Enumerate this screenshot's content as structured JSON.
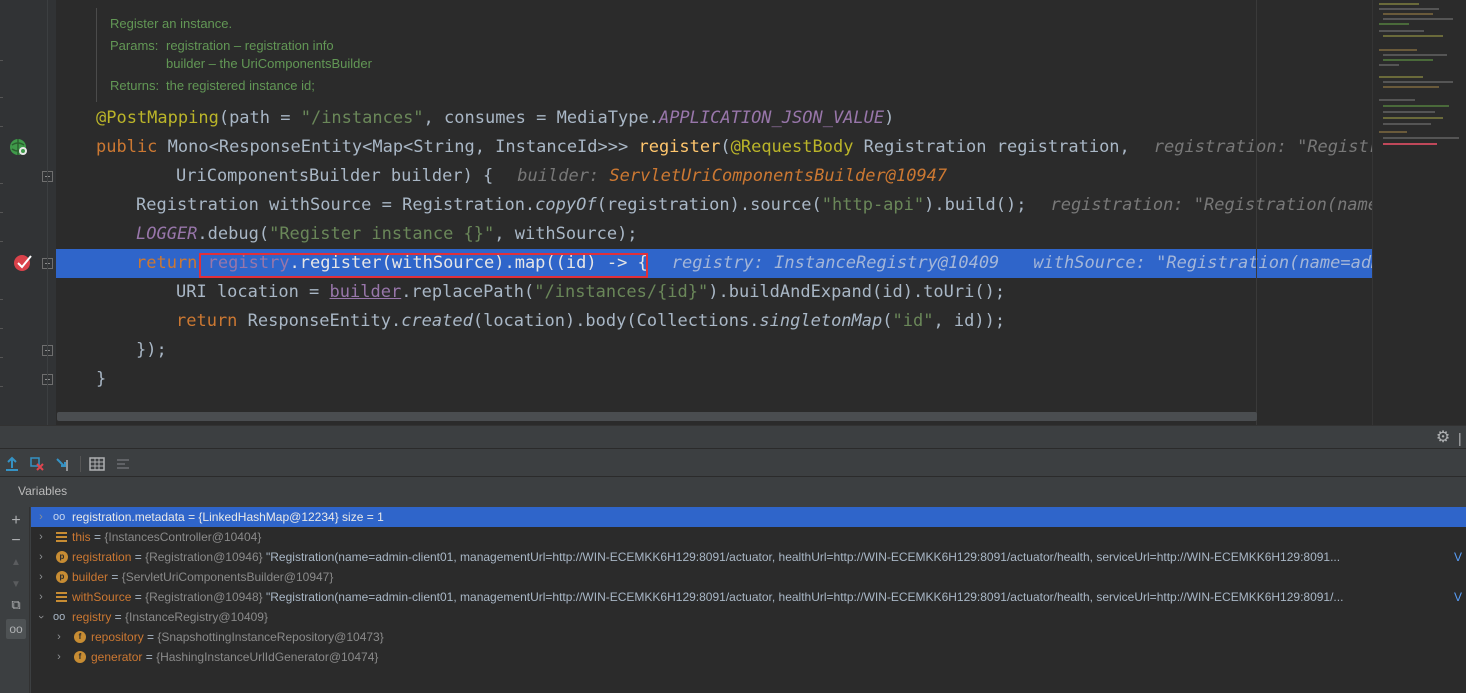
{
  "doc": {
    "summary": "Register an instance.",
    "params_label": "Params:",
    "param1": "registration – registration info",
    "param2": "builder – the UriComponentsBuilder",
    "returns_label": "Returns:",
    "returns": "the registered instance id;"
  },
  "code": {
    "l1_ann": "@PostMapping",
    "l1_a": "(path = ",
    "l1_str": "\"/instances\"",
    "l1_b": ", consumes = MediaType.",
    "l1_const": "APPLICATION_JSON_VALUE",
    "l1_c": ")",
    "l2_kw": "public ",
    "l2_a": "Mono<ResponseEntity<Map<String, InstanceId>>> ",
    "l2_fn": "register",
    "l2_b": "(",
    "l2_ann": "@RequestBody",
    "l2_c": " Registration registration,",
    "l2_hint_name": "registration: ",
    "l2_hint_val": "\"Registrat",
    "l3_a": "UriComponentsBuilder builder) {",
    "l3_hint_name": "builder: ",
    "l3_hint_val": "ServletUriComponentsBuilder@10947",
    "l4_a": "Registration withSource = Registration.",
    "l4_it": "copyOf",
    "l4_b": "(registration).source(",
    "l4_str": "\"http-api\"",
    "l4_c": ").build();",
    "l4_hint_name": "registration: ",
    "l4_hint_val": "\"Registration(name=ad",
    "l5_const": "LOGGER",
    "l5_a": ".debug(",
    "l5_str": "\"Register instance {}\"",
    "l5_b": ", withSource);",
    "l6_kw": "return ",
    "l6_fld": "registry",
    "l6_a": ".register(withSource).map((id) -> {",
    "l6_hint1": "registry: InstanceRegistry@10409",
    "l6_hint2": "withSource: \"Registration(name=admin",
    "l7_a": "URI location = ",
    "l7_u": "builder",
    "l7_b": ".replacePath(",
    "l7_str": "\"/instances/{id}\"",
    "l7_c": ").buildAndExpand(id).toUri();",
    "l8_kw": "return ",
    "l8_a": "ResponseEntity.",
    "l8_it": "created",
    "l8_b": "(location).body(Collections.",
    "l8_it2": "singletonMap",
    "l8_c": "(",
    "l8_str": "\"id\"",
    "l8_d": ", id));",
    "l9_a": "});",
    "l10_a": "}"
  },
  "debug": {
    "panel_title": "Variables",
    "settings_icon": "gear-icon",
    "vars": [
      {
        "name": "registration.metadata",
        "eq": " = ",
        "type": "{LinkedHashMap@12234}",
        "value": "  size = 1",
        "extra": ""
      },
      {
        "name": "this",
        "eq": " = ",
        "type": "{InstancesController@10404}",
        "value": "",
        "extra": ""
      },
      {
        "name": "registration",
        "eq": " = ",
        "type": "{Registration@10946}",
        "value": " \"Registration(name=admin-client01, managementUrl=http://WIN-ECEMKK6H129:8091/actuator, healthUrl=http://WIN-ECEMKK6H129:8091/actuator/health, serviceUrl=http://WIN-ECEMKK6H129:8091...",
        "extra": "V"
      },
      {
        "name": "builder",
        "eq": " = ",
        "type": "{ServletUriComponentsBuilder@10947}",
        "value": "",
        "extra": ""
      },
      {
        "name": "withSource",
        "eq": " = ",
        "type": "{Registration@10948}",
        "value": " \"Registration(name=admin-client01, managementUrl=http://WIN-ECEMKK6H129:8091/actuator, healthUrl=http://WIN-ECEMKK6H129:8091/actuator/health, serviceUrl=http://WIN-ECEMKK6H129:8091/...",
        "extra": "V"
      },
      {
        "name": "registry",
        "eq": " = ",
        "type": "{InstanceRegistry@10409}",
        "value": "",
        "extra": ""
      },
      {
        "name": "repository",
        "eq": " = ",
        "type": "{SnapshottingInstanceRepository@10473}",
        "value": "",
        "extra": ""
      },
      {
        "name": "generator",
        "eq": " = ",
        "type": "{HashingInstanceUrlIdGenerator@10474}",
        "value": "",
        "extra": ""
      }
    ]
  }
}
